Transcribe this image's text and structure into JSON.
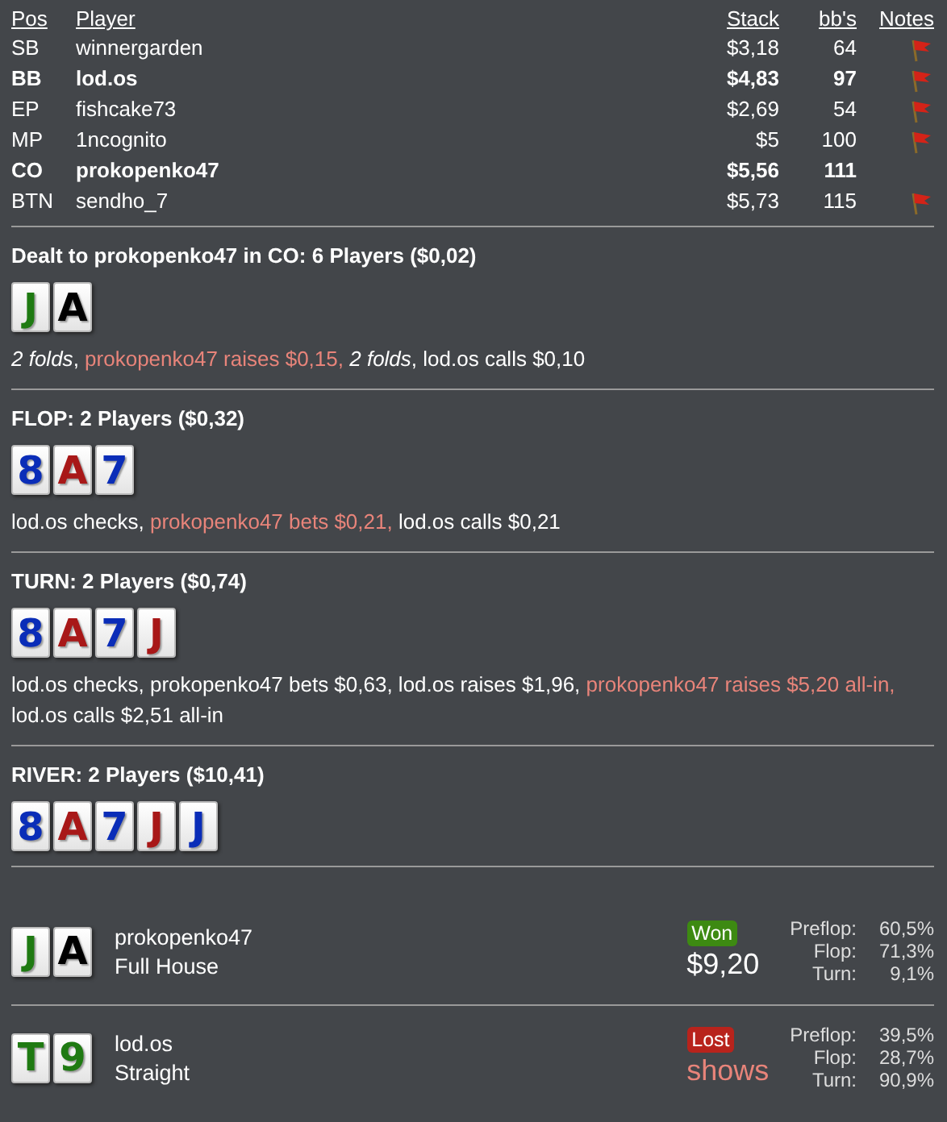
{
  "players": {
    "columns": [
      "Pos",
      "Player",
      "Stack",
      "bb's",
      "Notes"
    ],
    "rows": [
      {
        "pos": "SB",
        "name": "winnergarden",
        "stack": "$3,18",
        "bbs": "64",
        "in_hand": false,
        "has_note": true
      },
      {
        "pos": "BB",
        "name": "lod.os",
        "stack": "$4,83",
        "bbs": "97",
        "in_hand": true,
        "has_note": true
      },
      {
        "pos": "EP",
        "name": "fishcake73",
        "stack": "$2,69",
        "bbs": "54",
        "in_hand": false,
        "has_note": true
      },
      {
        "pos": "MP",
        "name": "1ncognito",
        "stack": "$5",
        "bbs": "100",
        "in_hand": false,
        "has_note": true
      },
      {
        "pos": "CO",
        "name": "prokopenko47",
        "stack": "$5,56",
        "bbs": "111",
        "in_hand": true,
        "has_note": false
      },
      {
        "pos": "BTN",
        "name": "sendho_7",
        "stack": "$5,73",
        "bbs": "115",
        "in_hand": false,
        "has_note": true
      }
    ]
  },
  "streets": [
    {
      "title": "Dealt to prokopenko47 in CO: 6 Players ($0,02)",
      "cards": [
        {
          "rank": "J",
          "color": "#1f7a12"
        },
        {
          "rank": "A",
          "color": "#000000"
        }
      ],
      "actions": [
        {
          "text": "*2 folds*, ",
          "kind": "plain"
        },
        {
          "text": "prokopenko47 raises $0,15, ",
          "kind": "hero"
        },
        {
          "text": "*2 folds*, lod.os calls $0,10",
          "kind": "plain"
        }
      ]
    },
    {
      "title": "FLOP: 2 Players ($0,32)",
      "cards": [
        {
          "rank": "8",
          "color": "#0a2db8"
        },
        {
          "rank": "A",
          "color": "#a81818"
        },
        {
          "rank": "7",
          "color": "#0a2db8"
        }
      ],
      "actions": [
        {
          "text": "lod.os checks, ",
          "kind": "plain"
        },
        {
          "text": "prokopenko47 bets $0,21, ",
          "kind": "hero"
        },
        {
          "text": "lod.os calls $0,21",
          "kind": "plain"
        }
      ]
    },
    {
      "title": "TURN: 2 Players ($0,74)",
      "cards": [
        {
          "rank": "8",
          "color": "#0a2db8"
        },
        {
          "rank": "A",
          "color": "#a81818"
        },
        {
          "rank": "7",
          "color": "#0a2db8"
        },
        {
          "rank": "J",
          "color": "#a81818"
        }
      ],
      "actions": [
        {
          "text": "lod.os checks, prokopenko47 bets $0,63, lod.os raises $1,96, ",
          "kind": "plain"
        },
        {
          "text": "prokopenko47 raises $5,20 all-in, ",
          "kind": "hero"
        },
        {
          "text": "lod.os calls $2,51 all-in",
          "kind": "plain"
        }
      ]
    },
    {
      "title": "RIVER: 2 Players ($10,41)",
      "cards": [
        {
          "rank": "8",
          "color": "#0a2db8"
        },
        {
          "rank": "A",
          "color": "#a81818"
        },
        {
          "rank": "7",
          "color": "#0a2db8"
        },
        {
          "rank": "J",
          "color": "#a81818"
        },
        {
          "rank": "J",
          "color": "#0a2db8"
        }
      ]
    }
  ],
  "results": [
    {
      "cards": [
        {
          "rank": "J",
          "color": "#1f7a12"
        },
        {
          "rank": "A",
          "color": "#000000"
        }
      ],
      "name": "prokopenko47",
      "hand": "Full House",
      "badge": "Won",
      "won": true,
      "amount": "$9,20",
      "equity": [
        {
          "label": "Preflop:",
          "value": "60,5%"
        },
        {
          "label": "Flop:",
          "value": "71,3%"
        },
        {
          "label": "Turn:",
          "value": "9,1%"
        }
      ]
    },
    {
      "cards": [
        {
          "rank": "T",
          "color": "#1f7a12"
        },
        {
          "rank": "9",
          "color": "#1f7a12"
        }
      ],
      "name": "lod.os",
      "hand": "Straight",
      "badge": "Lost",
      "won": false,
      "amount": "shows",
      "equity": [
        {
          "label": "Preflop:",
          "value": "39,5%"
        },
        {
          "label": "Flop:",
          "value": "28,7%"
        },
        {
          "label": "Turn:",
          "value": "90,9%"
        }
      ]
    }
  ]
}
